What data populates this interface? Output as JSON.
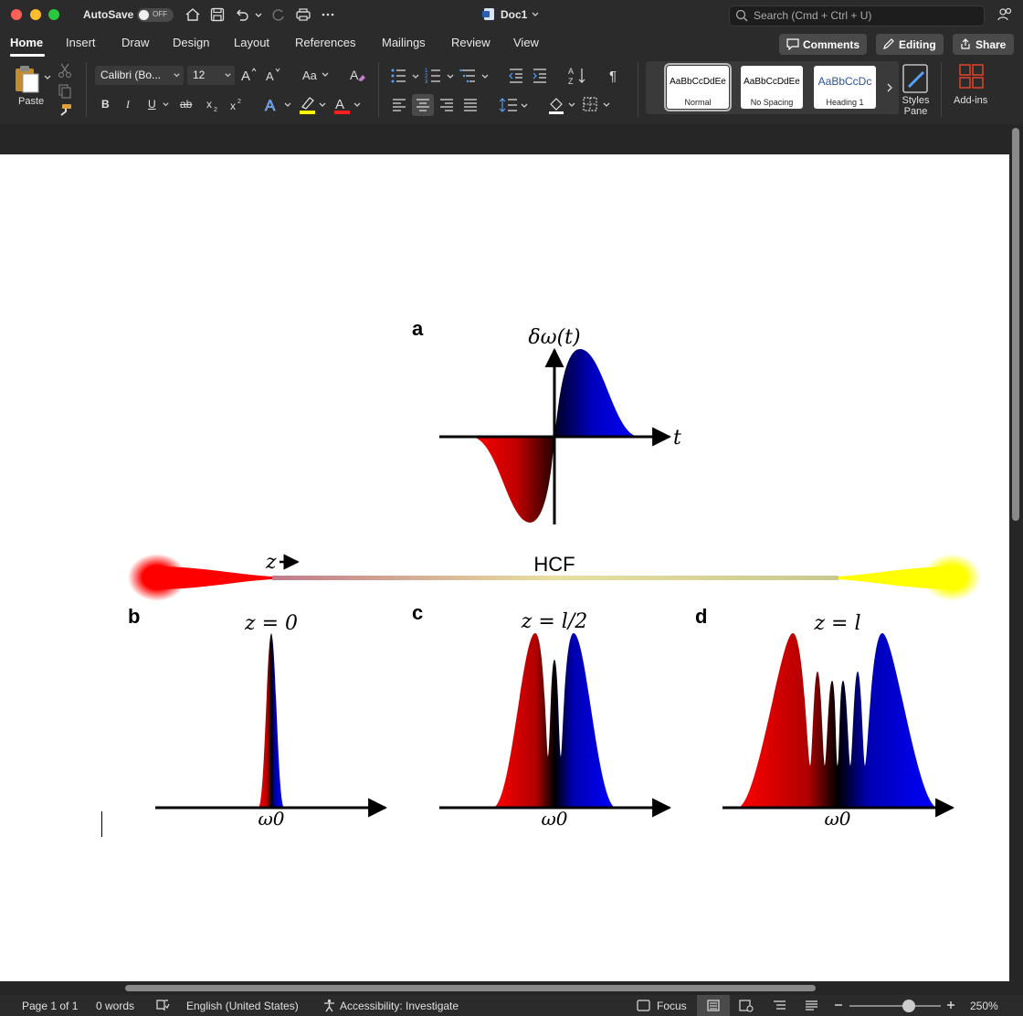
{
  "titlebar": {
    "autosave_label": "AutoSave",
    "autosave_state": "OFF",
    "doc_title": "Doc1",
    "search_placeholder": "Search (Cmd + Ctrl + U)"
  },
  "tabs": [
    "Home",
    "Insert",
    "Draw",
    "Design",
    "Layout",
    "References",
    "Mailings",
    "Review",
    "View"
  ],
  "active_tab": "Home",
  "actions": {
    "comments": "Comments",
    "editing": "Editing",
    "share": "Share"
  },
  "ribbon": {
    "paste_label": "Paste",
    "font_name": "Calibri (Bo...",
    "font_size": "12",
    "bold": "B",
    "italic": "I",
    "underline": "U",
    "strike": "ab",
    "styles": [
      {
        "sample": "AaBbCcDdEe",
        "name": "Normal",
        "selected": true
      },
      {
        "sample": "AaBbCcDdEe",
        "name": "No Spacing",
        "selected": false
      },
      {
        "sample": "AaBbCcDc",
        "name": "Heading 1",
        "selected": false
      }
    ],
    "styles_pane_label": "Styles Pane",
    "addins_label": "Add-ins"
  },
  "figure": {
    "panel_a": {
      "label": "a",
      "y_axis": "δω(t)",
      "x_axis": "t"
    },
    "fiber": {
      "label": "HCF",
      "z_label": "z"
    },
    "panel_b": {
      "label": "b",
      "title": "z = 0",
      "x_axis": "ω0"
    },
    "panel_c": {
      "label": "c",
      "title": "z = l/2",
      "x_axis": "ω0"
    },
    "panel_d": {
      "label": "d",
      "title": "z = l",
      "x_axis": "ω0"
    }
  },
  "colors": {
    "red": "#ff0000",
    "blue": "#0000ff",
    "yellow": "#ffff00",
    "black": "#000000"
  },
  "statusbar": {
    "page": "Page 1 of 1",
    "words": "0 words",
    "language": "English (United States)",
    "accessibility": "Accessibility: Investigate",
    "focus": "Focus",
    "zoom": "250%"
  }
}
